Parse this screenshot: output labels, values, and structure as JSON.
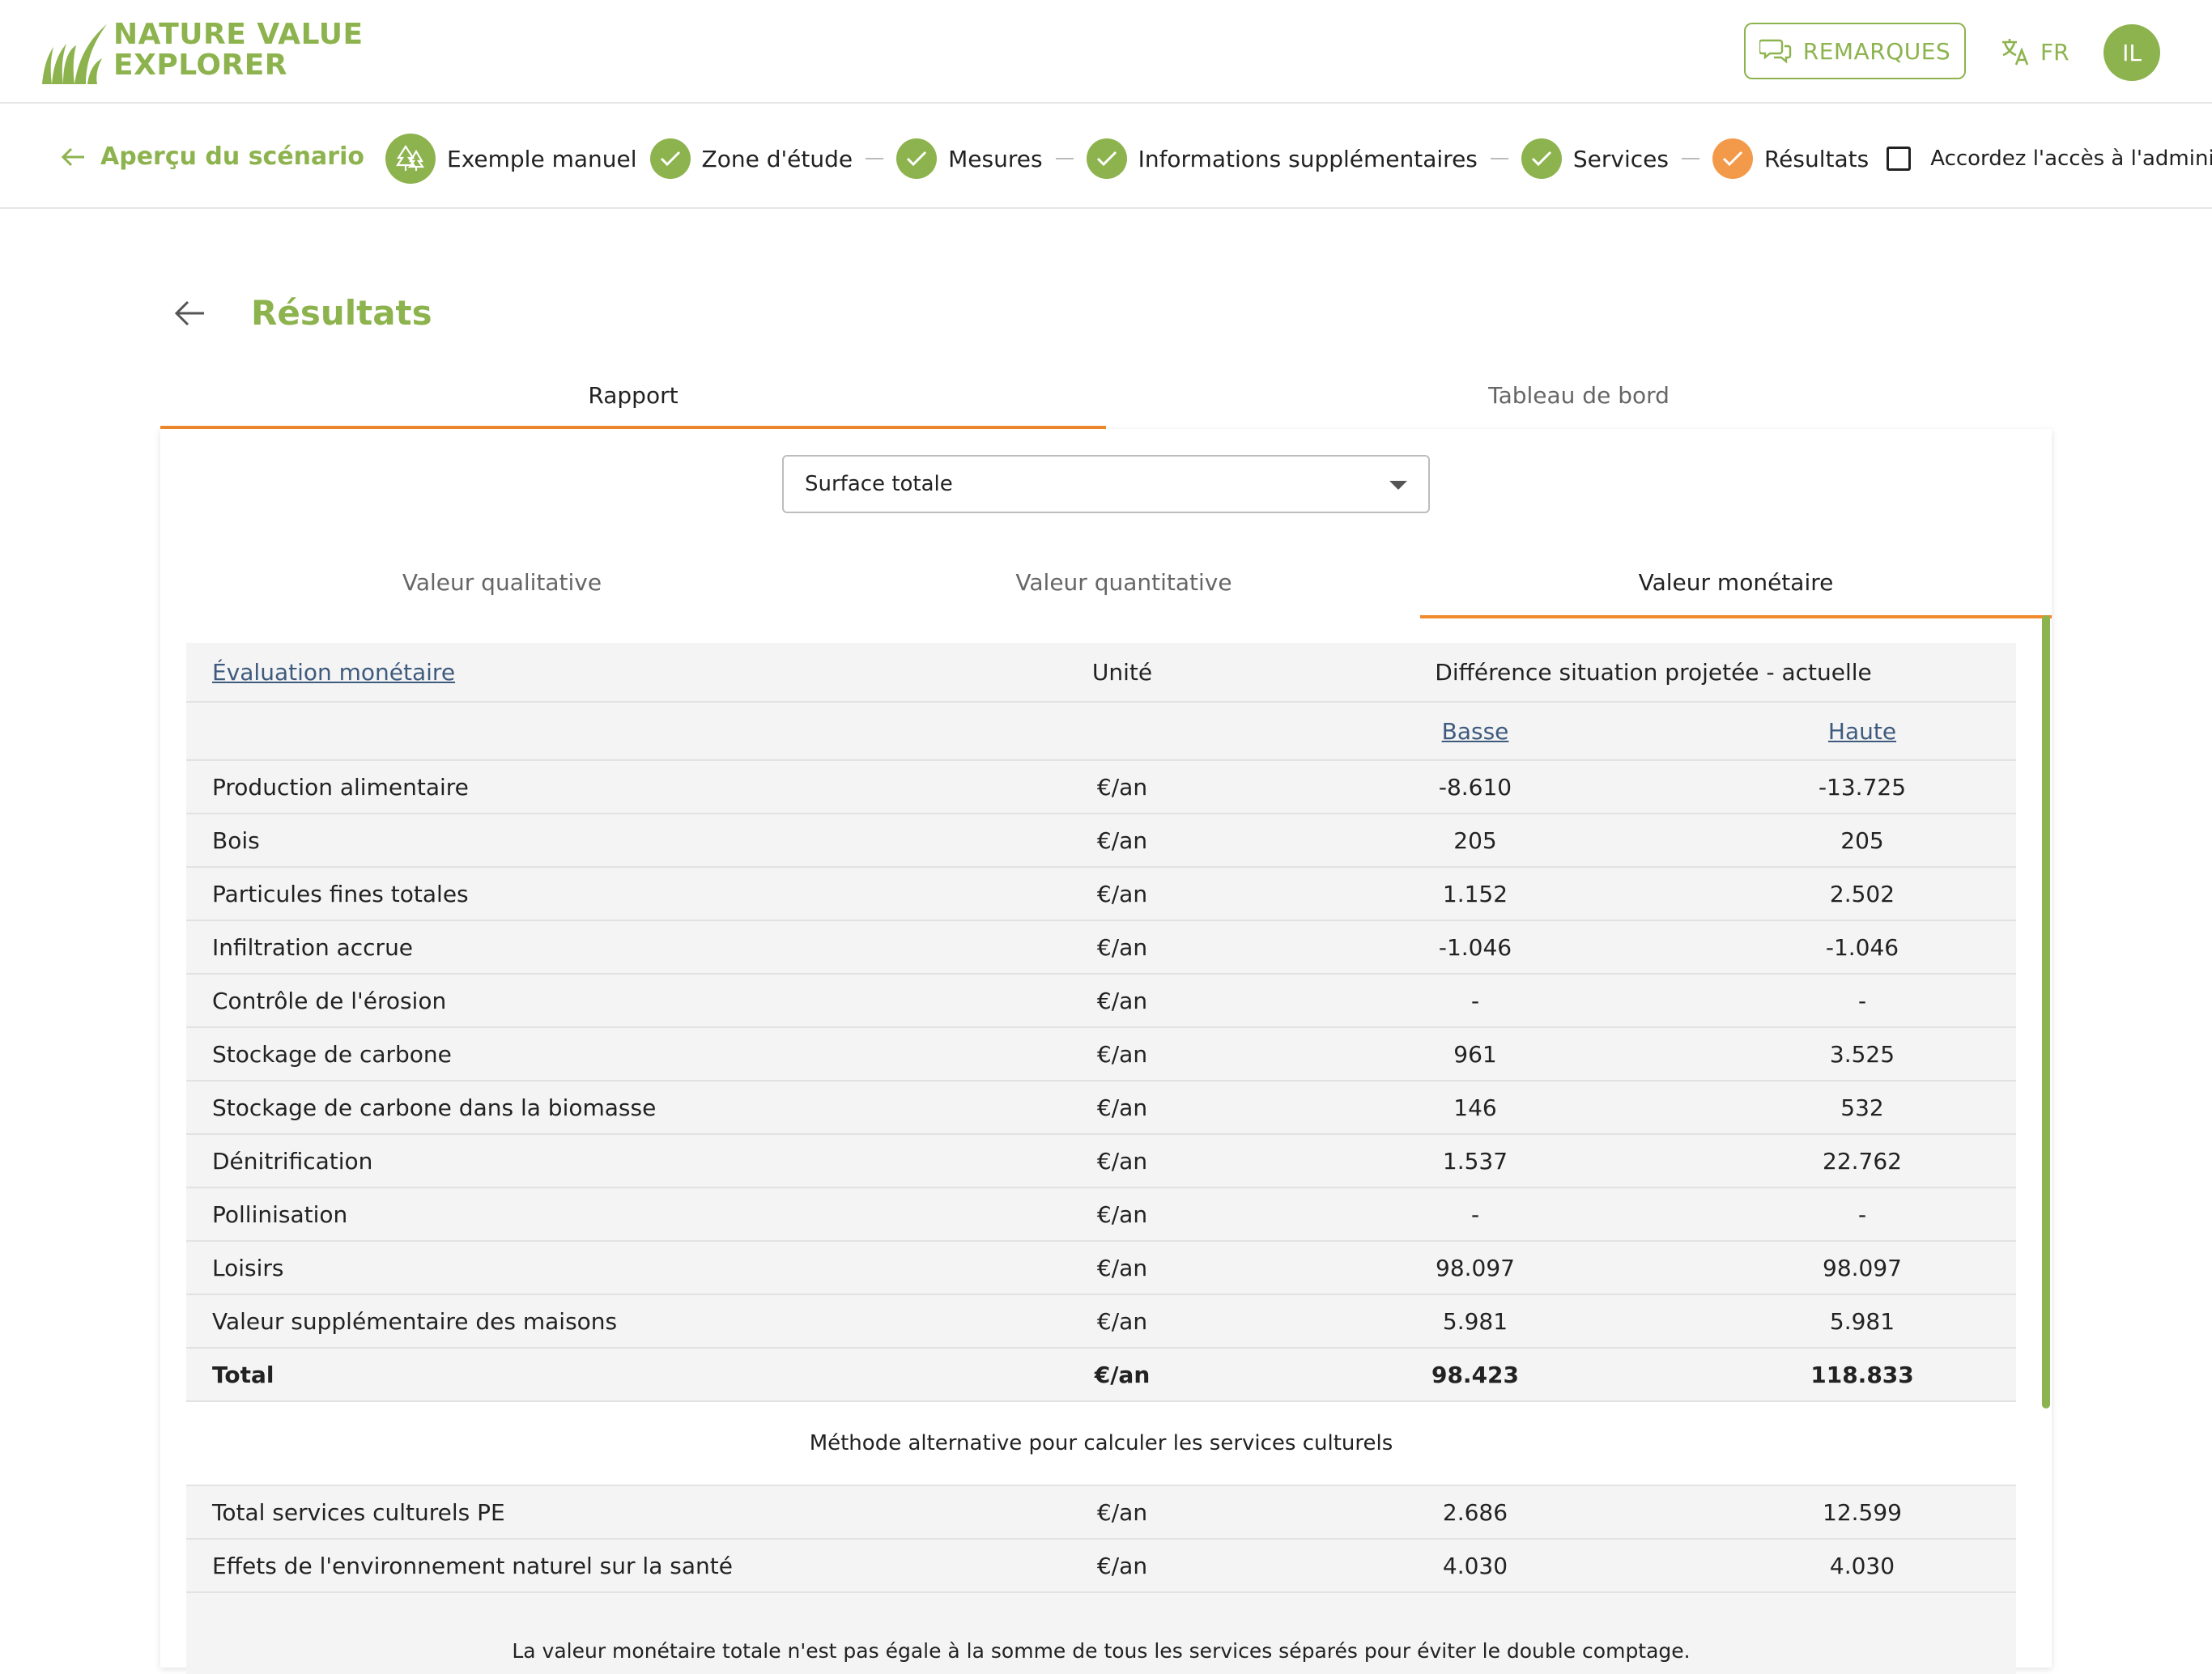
{
  "brand": {
    "line1": "NATURE VALUE",
    "line2": "EXPLORER"
  },
  "header": {
    "remarks_label": "REMARQUES",
    "language": "FR",
    "user_initials": "IL"
  },
  "stepper": {
    "back_label": "Aperçu du scénario",
    "steps": [
      {
        "label": "Exemple manuel",
        "state": "project"
      },
      {
        "label": "Zone d'étude",
        "state": "done"
      },
      {
        "label": "Mesures",
        "state": "done"
      },
      {
        "label": "Informations supplémentaires",
        "state": "done"
      },
      {
        "label": "Services",
        "state": "done"
      },
      {
        "label": "Résultats",
        "state": "current"
      }
    ],
    "admin_access_label": "Accordez l'accès à l'administrateur",
    "admin_access_checked": false
  },
  "page": {
    "title": "Résultats",
    "tabs": [
      "Rapport",
      "Tableau de bord"
    ],
    "active_tab": "Rapport"
  },
  "report": {
    "area_select_value": "Surface totale",
    "sub_tabs": [
      "Valeur qualitative",
      "Valeur quantitative",
      "Valeur monétaire"
    ],
    "active_sub_tab": "Valeur monétaire"
  },
  "table": {
    "col_name": "Évaluation monétaire",
    "col_unit": "Unité",
    "col_diff": "Différence situation projetée - actuelle",
    "col_low": "Basse",
    "col_high": "Haute",
    "rows": [
      {
        "name": "Production alimentaire",
        "unit": "€/an",
        "low": "-8.610",
        "high": "-13.725"
      },
      {
        "name": "Bois",
        "unit": "€/an",
        "low": "205",
        "high": "205"
      },
      {
        "name": "Particules fines totales",
        "unit": "€/an",
        "low": "1.152",
        "high": "2.502"
      },
      {
        "name": "Infiltration accrue",
        "unit": "€/an",
        "low": "-1.046",
        "high": "-1.046"
      },
      {
        "name": "Contrôle de l'érosion",
        "unit": "€/an",
        "low": "-",
        "high": "-"
      },
      {
        "name": "Stockage de carbone",
        "unit": "€/an",
        "low": "961",
        "high": "3.525"
      },
      {
        "name": "Stockage de carbone dans la biomasse",
        "unit": "€/an",
        "low": "146",
        "high": "532"
      },
      {
        "name": "Dénitrification",
        "unit": "€/an",
        "low": "1.537",
        "high": "22.762"
      },
      {
        "name": "Pollinisation",
        "unit": "€/an",
        "low": "-",
        "high": "-"
      },
      {
        "name": "Loisirs",
        "unit": "€/an",
        "low": "98.097",
        "high": "98.097"
      },
      {
        "name": "Valeur supplémentaire des maisons",
        "unit": "€/an",
        "low": "5.981",
        "high": "5.981"
      }
    ],
    "total": {
      "name": "Total",
      "unit": "€/an",
      "low": "98.423",
      "high": "118.833"
    },
    "alt_title": "Méthode alternative pour calculer les services culturels",
    "alt_rows": [
      {
        "name": "Total services culturels PE",
        "unit": "€/an",
        "low": "2.686",
        "high": "12.599"
      },
      {
        "name": "Effets de l'environnement naturel sur la santé",
        "unit": "€/an",
        "low": "4.030",
        "high": "4.030"
      }
    ],
    "note": "La valeur monétaire totale n'est pas égale à la somme de tous les services séparés pour éviter le double comptage."
  },
  "colors": {
    "brand_green": "#8db34e",
    "accent_orange": "#f08a2c",
    "link_blue": "#3e5b7e"
  },
  "icons": [
    "grass-logo-icon",
    "chat-bubbles-icon",
    "translate-icon",
    "arrow-left-icon",
    "tree-icon",
    "check-icon"
  ]
}
